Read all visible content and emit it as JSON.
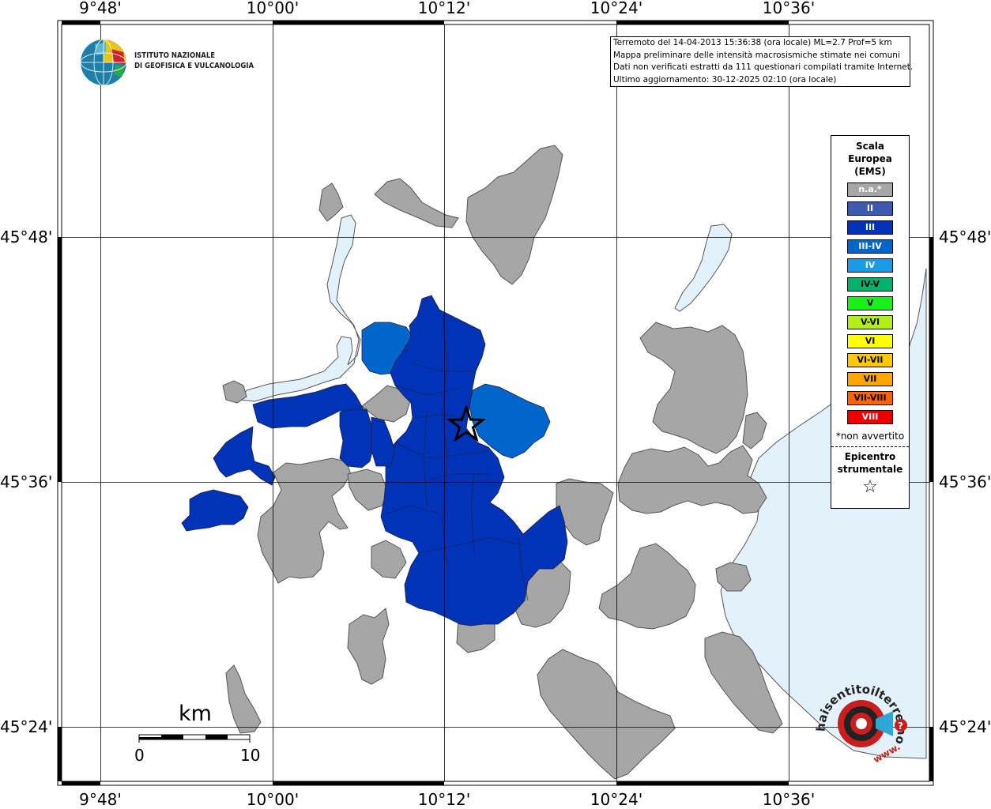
{
  "map": {
    "longitude_labels": [
      "9°48'",
      "10°00'",
      "10°12'",
      "10°24'",
      "10°36'"
    ],
    "latitude_labels": [
      "45°48'",
      "45°36'",
      "45°24'"
    ],
    "colors": {
      "na": "#a6a6a6",
      "II": "#3d5ab0",
      "III": "#0033b8",
      "III-IV": "#0066cc",
      "water": "#e3f1fb",
      "border": "#444444"
    }
  },
  "infobox": {
    "line1": "Terremoto del 14-04-2013 15:36:38 (ora locale) ML=2.7 Prof=5 km",
    "line2": "Mappa preliminare delle intensità macrosismiche stimate nei comuni",
    "line3": "Dati non verificati estratti da 111 questionari compilati tramite Internet.",
    "line4": "Ultimo aggiornamento: 30-12-2025 02:10 (ora locale)"
  },
  "logo": {
    "line1": "ISTITUTO NAZIONALE",
    "line2": "DI GEOFISICA E VULCANOLOGIA"
  },
  "legend": {
    "title1": "Scala",
    "title2": "Europea",
    "title3": "(EMS)",
    "items": [
      {
        "label": "n.a.*",
        "color": "#a6a6a6",
        "text_color": "#ffffff"
      },
      {
        "label": "II",
        "color": "#3d5ab0",
        "text_color": "#ffffff"
      },
      {
        "label": "III",
        "color": "#0033b8",
        "text_color": "#ffffff"
      },
      {
        "label": "III-IV",
        "color": "#0066cc",
        "text_color": "#ffffff"
      },
      {
        "label": "IV",
        "color": "#1a9be6",
        "text_color": "#ffffff"
      },
      {
        "label": "IV-V",
        "color": "#00b26e",
        "text_color": "#000000"
      },
      {
        "label": "V",
        "color": "#1aef1a",
        "text_color": "#000000"
      },
      {
        "label": "V-VI",
        "color": "#b2ef1a",
        "text_color": "#000000"
      },
      {
        "label": "VI",
        "color": "#ffff00",
        "text_color": "#000000"
      },
      {
        "label": "VI-VII",
        "color": "#ffc800",
        "text_color": "#000000"
      },
      {
        "label": "VII",
        "color": "#ffa500",
        "text_color": "#000000"
      },
      {
        "label": "VII-VIII",
        "color": "#ff6400",
        "text_color": "#000000"
      },
      {
        "label": "VIII",
        "color": "#ee0000",
        "text_color": "#ffffff"
      }
    ],
    "note": "*non avvertito",
    "epicenter1": "Epicentro",
    "epicenter2": "strumentale",
    "star": "☆"
  },
  "scale": {
    "title": "km",
    "start": "0",
    "end": "10"
  },
  "brand": {
    "text1": "haisentitoilterremoto.it",
    "text2": "www."
  }
}
